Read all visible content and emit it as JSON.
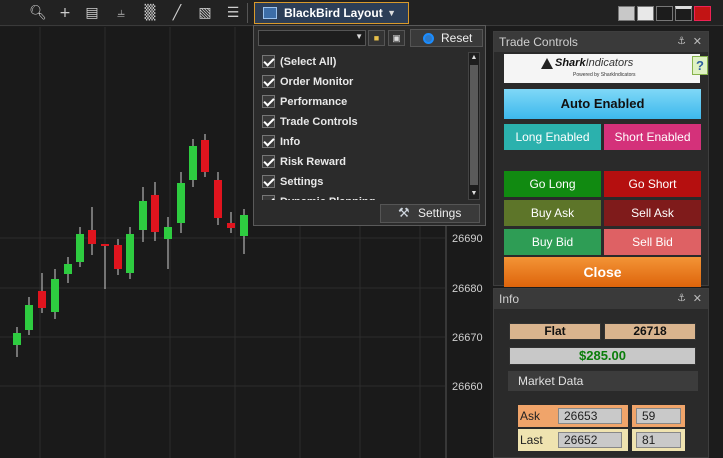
{
  "toolbar": {
    "icons": [
      "zoom-icon",
      "crosshair-icon",
      "data-box-icon",
      "bar-chart-icon",
      "candles-icon",
      "draw-line-icon",
      "indicators-icon",
      "list-icon"
    ],
    "layout_button_label": "BlackBird Layout"
  },
  "chart": {
    "price_labels": [
      "26690",
      "26680",
      "26670",
      "26660"
    ]
  },
  "layout_menu": {
    "reset_label": "Reset",
    "settings_label": "Settings",
    "items": [
      {
        "label": "(Select All)"
      },
      {
        "label": "Order Monitor"
      },
      {
        "label": "Performance"
      },
      {
        "label": "Trade Controls"
      },
      {
        "label": "Info"
      },
      {
        "label": "Risk Reward"
      },
      {
        "label": "Settings"
      },
      {
        "label": "Dynamic Planning"
      }
    ]
  },
  "trade_controls": {
    "title": "Trade Controls",
    "logo_text": "Shark",
    "logo_text_light": "Indicators",
    "logo_sub": "Powered by SharkIndicators",
    "help": "?",
    "auto_enabled": "Auto Enabled",
    "long_enabled": "Long Enabled",
    "short_enabled": "Short Enabled",
    "go_long": "Go Long",
    "go_short": "Go Short",
    "buy_ask": "Buy Ask",
    "sell_ask": "Sell Ask",
    "buy_bid": "Buy Bid",
    "sell_bid": "Sell Bid",
    "close": "Close"
  },
  "info": {
    "title": "Info",
    "position": "Flat",
    "price": "26718",
    "pnl": "$285.00",
    "market_data_title": "Market Data",
    "ask_label": "Ask",
    "ask_price": "26653",
    "ask_size": "59",
    "last_label": "Last",
    "last_price": "26652",
    "last_size": "81"
  },
  "colors": {
    "bull": "#2ecc40",
    "bear": "#e0141e",
    "accent_border": "#d99a2b"
  }
}
